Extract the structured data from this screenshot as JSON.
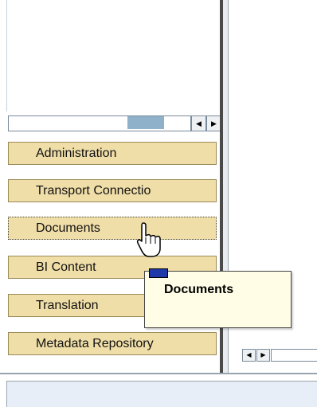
{
  "navigation": {
    "items": [
      {
        "label": "Administration"
      },
      {
        "label": "Transport Connectio"
      },
      {
        "label": "Documents"
      },
      {
        "label": "BI Content"
      },
      {
        "label": "Translation"
      },
      {
        "label": "Metadata Repository"
      }
    ],
    "active_index": 2
  },
  "tooltip": {
    "text": "Documents"
  },
  "scrollbar": {
    "left_arrow_icon": "arrow-left-icon",
    "right_arrow_icon": "arrow-right-icon"
  },
  "cursor": {
    "icon": "hand-pointer-icon"
  },
  "colors": {
    "nav_bar": "#f0dea8",
    "nav_border": "#9c8a58",
    "tooltip_bg": "#fffde6",
    "scroll_thumb": "#8fb1c9",
    "status_bar": "#e7eef7"
  }
}
